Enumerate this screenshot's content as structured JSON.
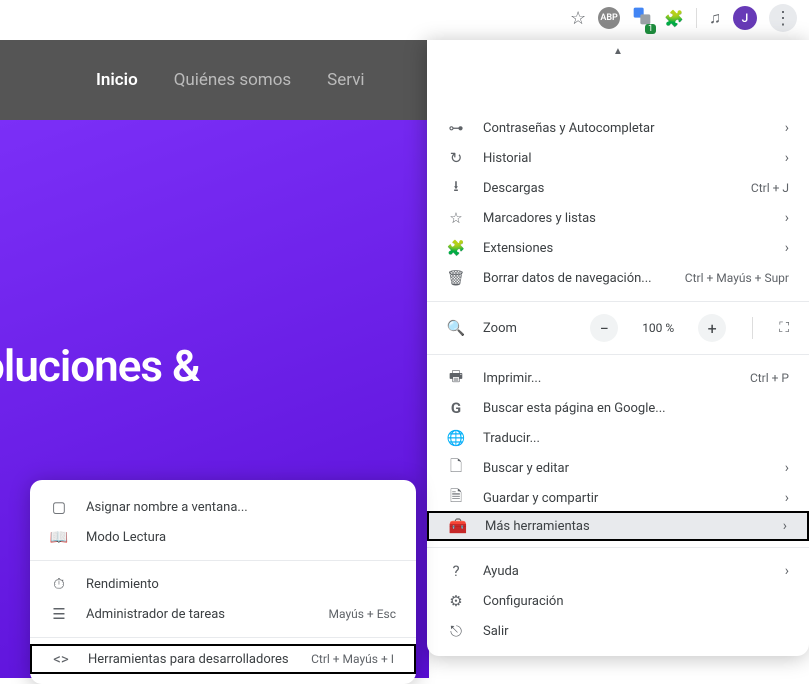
{
  "toolbar": {
    "abp_label": "ABP",
    "translate_count": "1",
    "avatar_initial": "J"
  },
  "nav": {
    "items": [
      {
        "label": "Inicio",
        "active": true
      },
      {
        "label": "Quiénes somos",
        "active": false
      },
      {
        "label": "Servi",
        "active": false
      }
    ]
  },
  "hero": {
    "title_fragment": "oluciones &"
  },
  "main_menu": {
    "items_a": [
      {
        "icon": "key",
        "label": "Contraseñas y Autocompletar",
        "chevron": true
      },
      {
        "icon": "history",
        "label": "Historial",
        "chevron": true
      },
      {
        "icon": "download",
        "label": "Descargas",
        "shortcut": "Ctrl + J"
      },
      {
        "icon": "star",
        "label": "Marcadores y listas",
        "chevron": true
      },
      {
        "icon": "puzzle",
        "label": "Extensiones",
        "chevron": true
      },
      {
        "icon": "trash",
        "label": "Borrar datos de navegación...",
        "shortcut": "Ctrl + Mayús + Supr"
      }
    ],
    "zoom": {
      "label": "Zoom",
      "value": "100 %",
      "minus": "−",
      "plus": "+"
    },
    "items_b": [
      {
        "icon": "print",
        "label": "Imprimir...",
        "shortcut": "Ctrl + P"
      },
      {
        "icon": "google",
        "label": "Buscar esta página en Google..."
      },
      {
        "icon": "translate",
        "label": "Traducir..."
      },
      {
        "icon": "search-page",
        "label": "Buscar y editar",
        "chevron": true
      },
      {
        "icon": "share",
        "label": "Guardar y compartir",
        "chevron": true
      },
      {
        "icon": "toolbox",
        "label": "Más herramientas",
        "chevron": true,
        "highlighted": true
      }
    ],
    "items_c": [
      {
        "icon": "help",
        "label": "Ayuda",
        "chevron": true
      },
      {
        "icon": "gear",
        "label": "Configuración"
      },
      {
        "icon": "exit",
        "label": "Salir"
      }
    ]
  },
  "submenu": {
    "items_a": [
      {
        "icon": "window",
        "label": "Asignar nombre a ventana..."
      },
      {
        "icon": "reader",
        "label": "Modo Lectura"
      }
    ],
    "items_b": [
      {
        "icon": "perf",
        "label": "Rendimiento"
      },
      {
        "icon": "taskmgr",
        "label": "Administrador de tareas",
        "shortcut": "Mayús + Esc"
      }
    ],
    "items_c": [
      {
        "icon": "code",
        "label": "Herramientas para desarrolladores",
        "shortcut": "Ctrl + Mayús + I",
        "boxed": true
      }
    ]
  }
}
